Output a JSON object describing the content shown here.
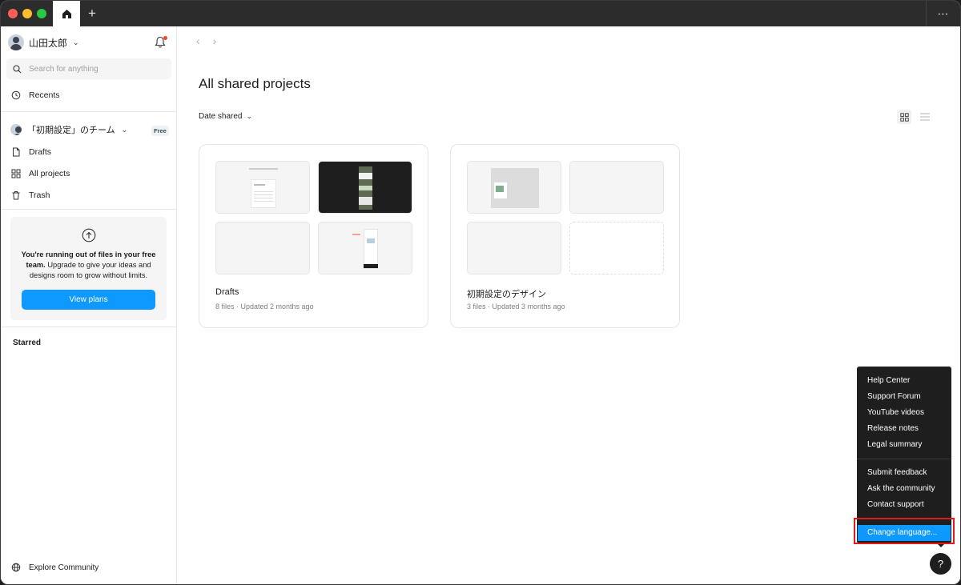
{
  "titlebar": {
    "more_label": "⋯"
  },
  "sidebar": {
    "user_name": "山田太郎",
    "search_placeholder": "Search for anything",
    "recents_label": "Recents",
    "team_name": "「初期設定」のチーム",
    "team_badge": "Free",
    "items": [
      {
        "label": "Drafts",
        "icon": "file-icon"
      },
      {
        "label": "All projects",
        "icon": "grid-icon"
      },
      {
        "label": "Trash",
        "icon": "trash-icon"
      }
    ],
    "upgrade": {
      "bold_text": "You're running out of files in your free team.",
      "text": " Upgrade to give your ideas and designs room to grow without limits.",
      "button_label": "View plans"
    },
    "starred_label": "Starred",
    "explore_label": "Explore Community"
  },
  "main": {
    "title": "All shared projects",
    "sort_label": "Date shared",
    "projects": [
      {
        "name": "Drafts",
        "meta": "8 files · Updated 2 months ago"
      },
      {
        "name": "初期設定のデザイン",
        "meta": "3 files · Updated 3 months ago"
      }
    ]
  },
  "help_menu": {
    "group1": [
      "Help Center",
      "Support Forum",
      "YouTube videos",
      "Release notes",
      "Legal summary"
    ],
    "group2": [
      "Submit feedback",
      "Ask the community",
      "Contact support"
    ],
    "group3": [
      "Change language..."
    ],
    "help_button_label": "?"
  },
  "colors": {
    "accent": "#0d99ff",
    "titlebar": "#2c2c2c",
    "highlight": "#e01b1b"
  }
}
